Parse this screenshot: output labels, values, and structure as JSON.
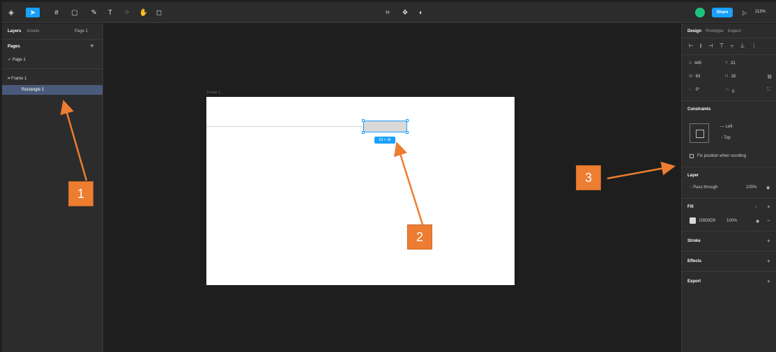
{
  "toolbar": {
    "share_label": "Share",
    "zoom_label": "113%",
    "play_icon": "play-icon"
  },
  "left_panel": {
    "tabs": [
      "Layers",
      "Assets"
    ],
    "page_switcher": "Page 1",
    "pages_title": "Pages",
    "add_page": "+",
    "page_item": "Page 1",
    "frame_item": "Frame 1",
    "rect_item": "Rectangle 1"
  },
  "canvas": {
    "frame_label": "Frame 1",
    "size_badge": "63 × 18"
  },
  "right_panel": {
    "tabs": [
      "Design",
      "Prototype",
      "Inspect"
    ],
    "x_label": "X",
    "x_value": "445",
    "y_label": "Y",
    "y_value": "31",
    "w_label": "W",
    "w_value": "63",
    "h_label": "H",
    "h_value": "18",
    "rotation_value": "0°",
    "radius_value": "0",
    "constraints_title": "Constraints",
    "constraint_left": "Left",
    "constraint_top": "Top",
    "fix_position": "Fix position when scrolling",
    "layer_title": "Layer",
    "pass_through": "Pass through",
    "layer_opacity": "100%",
    "fill_title": "Fill",
    "fill_hex": "D9D9D9",
    "fill_opacity": "100%",
    "stroke_title": "Stroke",
    "effects_title": "Effects",
    "export_title": "Export"
  },
  "annotations": {
    "callout1": "1",
    "callout2": "2",
    "callout3": "3"
  },
  "colors": {
    "accent": "#18a0fb",
    "callout": "#ed7d31"
  }
}
